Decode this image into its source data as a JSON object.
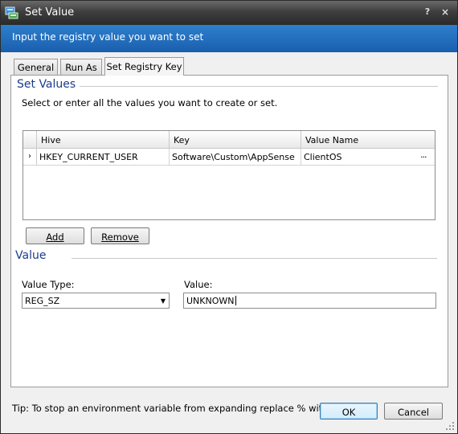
{
  "window": {
    "title": "Set Value",
    "help_symbol": "?",
    "close_symbol": "×"
  },
  "banner": {
    "text": "Input the registry value you want to set"
  },
  "tabs": [
    {
      "label": "General",
      "active": false
    },
    {
      "label": "Run As",
      "active": false
    },
    {
      "label": "Set Registry Key",
      "active": true
    }
  ],
  "set_values": {
    "title": "Set Values",
    "hint": "Select or enter all the values you want to create or set.",
    "grid": {
      "columns": [
        "Hive",
        "Key",
        "Value Name"
      ],
      "rows": [
        {
          "selector": "›",
          "hive": "HKEY_CURRENT_USER",
          "key": "Software\\Custom\\AppSense",
          "value_name": "ClientOS",
          "ellipsis": "···"
        }
      ]
    },
    "add_label": "Add",
    "remove_label": "Remove"
  },
  "value": {
    "title": "Value",
    "type_label": "Value Type:",
    "type_selected": "REG_SZ",
    "value_label": "Value:",
    "value_text": "UNKNOWN"
  },
  "footer": {
    "tip": "Tip: To stop an environment variable from expanding replace % with %%.",
    "ok_label": "OK",
    "cancel_label": "Cancel"
  },
  "icons": {
    "app": "registry-icon",
    "help": "help-icon",
    "close": "close-icon",
    "dropdown": "chevron-down-icon",
    "grip": "resize-grip-icon"
  },
  "colors": {
    "banner": "#1f6ebd",
    "section_title": "#1a3d8c",
    "titlebar": "#3a3a3a"
  }
}
